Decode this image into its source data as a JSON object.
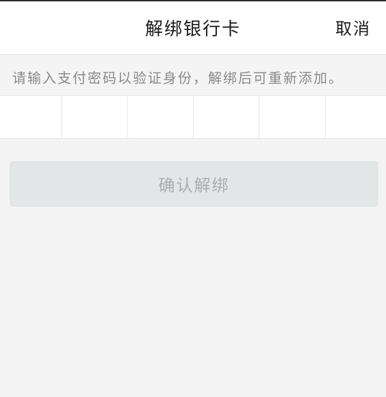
{
  "header": {
    "title": "解绑银行卡",
    "cancel_label": "取消"
  },
  "hint": "请输入支付密码以验证身份，解绑后可重新添加。",
  "password": {
    "digits": 6,
    "filled": 0
  },
  "confirm_label": "确认解绑",
  "colors": {
    "background": "#f4f4f4",
    "panel": "#ffffff",
    "button_disabled": "#e3e6e6",
    "button_text_disabled": "#a9aeae",
    "hint_text": "#8a8a8a"
  }
}
